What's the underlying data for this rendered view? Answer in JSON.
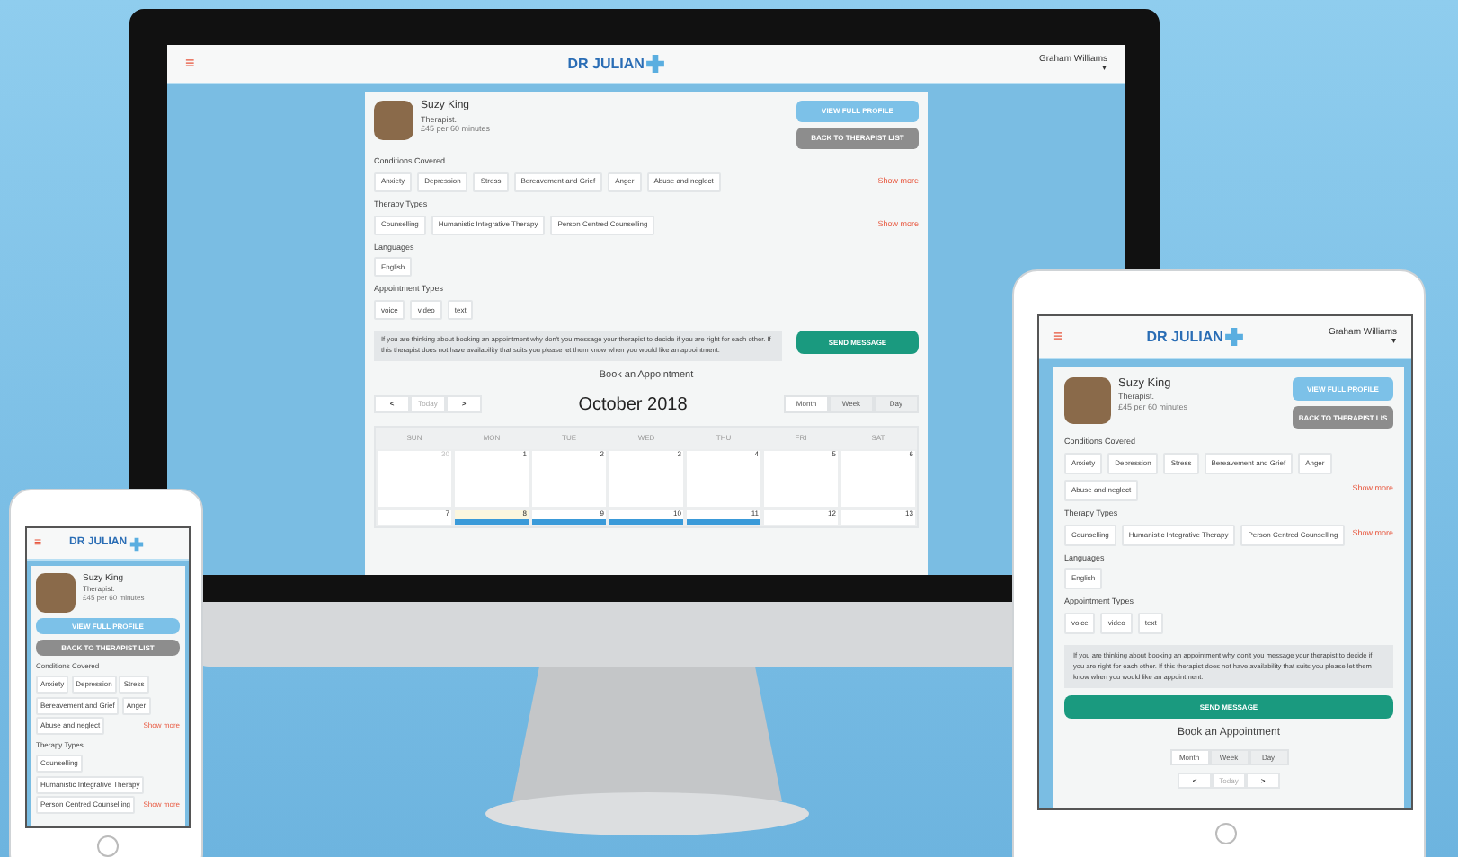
{
  "desktop": {
    "header": {
      "menu": "≡",
      "logo": "DR JULIAN",
      "user": "Graham Williams",
      "caret": "▾"
    },
    "profile": {
      "name": "Suzy King",
      "role": "Therapist.",
      "price": "£45 per 60 minutes",
      "buttons": [
        "VIEW FULL PROFILE",
        "BACK TO THERAPIST LIST"
      ]
    },
    "sections": [
      {
        "title": "Conditions Covered",
        "chips": [
          "Anxiety",
          "Depression",
          "Stress",
          "Bereavement and Grief",
          "Anger",
          "Abuse and neglect"
        ],
        "show_more": "Show more"
      },
      {
        "title": "Therapy Types",
        "chips": [
          "Counselling",
          "Humanistic Integrative Therapy",
          "Person Centred Counselling"
        ],
        "show_more": "Show more"
      },
      {
        "title": "Languages",
        "chips": [
          "English"
        ]
      },
      {
        "title": "Appointment Types",
        "chips": [
          "voice",
          "video",
          "text"
        ]
      }
    ],
    "notice": "If you are thinking about booking an appointment why don't you message your therapist to decide if you are right for each other. If this therapist does not have availability that suits you please let them know when you would like an appointment.",
    "send_button": "SEND MESSAGE",
    "booking": {
      "title": "Book an Appointment",
      "nav": [
        "<",
        "Today",
        ">"
      ],
      "month": "October 2018",
      "views": [
        {
          "label": "Month",
          "selected": true
        },
        {
          "label": "Week",
          "selected": false
        },
        {
          "label": "Day",
          "selected": false
        }
      ],
      "weekdays": [
        "SUN",
        "MON",
        "TUE",
        "WED",
        "THU",
        "FRI",
        "SAT"
      ],
      "weeks": [
        [
          {
            "day": "30",
            "muted": true,
            "today": false,
            "event": false
          },
          {
            "day": "1",
            "muted": false,
            "today": false,
            "event": false
          },
          {
            "day": "2",
            "muted": false,
            "today": false,
            "event": false
          },
          {
            "day": "3",
            "muted": false,
            "today": false,
            "event": false
          },
          {
            "day": "4",
            "muted": false,
            "today": false,
            "event": false
          },
          {
            "day": "5",
            "muted": false,
            "today": false,
            "event": false
          },
          {
            "day": "6",
            "muted": false,
            "today": false,
            "event": false
          }
        ],
        [
          {
            "day": "7",
            "muted": false,
            "today": false,
            "event": false
          },
          {
            "day": "8",
            "muted": false,
            "today": true,
            "event": true
          },
          {
            "day": "9",
            "muted": false,
            "today": false,
            "event": true
          },
          {
            "day": "10",
            "muted": false,
            "today": false,
            "event": true
          },
          {
            "day": "11",
            "muted": false,
            "today": false,
            "event": true
          },
          {
            "day": "12",
            "muted": false,
            "today": false,
            "event": false
          },
          {
            "day": "13",
            "muted": false,
            "today": false,
            "event": false
          }
        ]
      ]
    }
  },
  "tablet": {
    "header": {
      "menu": "≡",
      "logo": "DR JULIAN",
      "user": "Graham Williams",
      "caret": "▾"
    },
    "profile": {
      "name": "Suzy King",
      "role": "Therapist.",
      "price": "£45 per 60 minutes",
      "buttons": [
        "VIEW FULL PROFILE",
        "BACK TO THERAPIST LIS"
      ]
    },
    "sections": [
      {
        "title": "Conditions Covered",
        "chips": [
          "Anxiety",
          "Depression",
          "Stress",
          "Bereavement and Grief",
          "Anger",
          "Abuse and neglect"
        ],
        "show_more": "Show more"
      },
      {
        "title": "Therapy Types",
        "chips": [
          "Counselling",
          "Humanistic Integrative Therapy",
          "Person Centred Counselling"
        ],
        "show_more": "Show more"
      },
      {
        "title": "Languages",
        "chips": [
          "English"
        ]
      },
      {
        "title": "Appointment Types",
        "chips": [
          "voice",
          "video",
          "text"
        ]
      }
    ],
    "notice": "If you are thinking about booking an appointment why don't you message your therapist to decide if you are right for each other. If this therapist does not have availability that suits you please let them know when you would like an appointment.",
    "send_button": "SEND MESSAGE",
    "booking": {
      "title": "Book an Appointment",
      "nav": [
        "<",
        "Today",
        ">"
      ],
      "views": [
        {
          "label": "Month",
          "selected": true
        },
        {
          "label": "Week",
          "selected": false
        },
        {
          "label": "Day",
          "selected": false
        }
      ]
    }
  },
  "phone": {
    "header": {
      "menu": "≡",
      "logo": "DR JULIAN"
    },
    "profile": {
      "name": "Suzy King",
      "role": "Therapist.",
      "price": "£45 per 60 minutes",
      "buttons": [
        "VIEW FULL PROFILE",
        "BACK TO THERAPIST LIST"
      ]
    },
    "sections": [
      {
        "title": "Conditions Covered",
        "chips": [
          "Anxiety",
          "Depression",
          "Stress",
          "Bereavement and Grief",
          "Anger",
          "Abuse and neglect"
        ],
        "show_more": "Show more"
      },
      {
        "title": "Therapy Types",
        "chips": [
          "Counselling",
          "Humanistic Integrative Therapy",
          "Person Centred Counselling"
        ],
        "show_more": "Show more"
      }
    ]
  }
}
